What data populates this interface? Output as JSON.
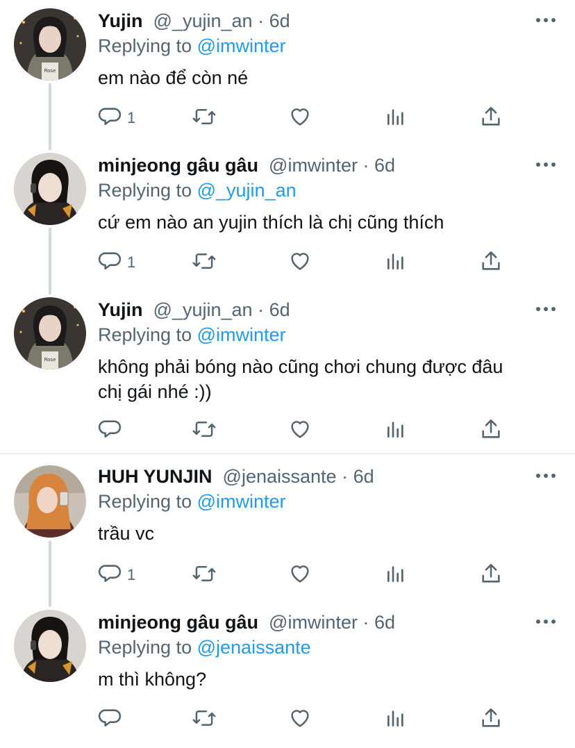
{
  "colors": {
    "link": "#1d9bf0",
    "muted": "#536471",
    "text": "#0f1419"
  },
  "tweets": [
    {
      "name": "Yujin",
      "handle": "@_yujin_an",
      "dot": "·",
      "time": "6d",
      "reply_label": "Replying to",
      "reply_mention": "@imwinter",
      "text_lines": [
        "em nào để còn né"
      ],
      "reply_count": "1",
      "avatar": "yujin"
    },
    {
      "name": "minjeong gâu gâu",
      "handle": "@imwinter",
      "dot": "·",
      "time": "6d",
      "reply_label": "Replying to",
      "reply_mention": "@_yujin_an",
      "text_lines": [
        "cứ em nào an yujin thích là chị cũng thích"
      ],
      "reply_count": "1",
      "avatar": "minjeong"
    },
    {
      "name": "Yujin",
      "handle": "@_yujin_an",
      "dot": "·",
      "time": "6d",
      "reply_label": "Replying to",
      "reply_mention": "@imwinter",
      "text_lines": [
        "không phải bóng nào cũng chơi chung được đâu",
        "chị gái nhé :))"
      ],
      "reply_count": "",
      "avatar": "yujin"
    },
    {
      "name": "HUH YUNJIN",
      "handle": "@jenaissante",
      "dot": "·",
      "time": "6d",
      "reply_label": "Replying to",
      "reply_mention": "@imwinter",
      "text_lines": [
        "trầu vc"
      ],
      "reply_count": "1",
      "avatar": "yunjin"
    },
    {
      "name": "minjeong gâu gâu",
      "handle": "@imwinter",
      "dot": "·",
      "time": "6d",
      "reply_label": "Replying to",
      "reply_mention": "@jenaissante",
      "text_lines": [
        "m thì không?"
      ],
      "reply_count": "",
      "avatar": "minjeong"
    }
  ],
  "icons": [
    "reply-icon",
    "retweet-icon",
    "like-icon",
    "analytics-icon",
    "share-icon",
    "more-icon"
  ]
}
